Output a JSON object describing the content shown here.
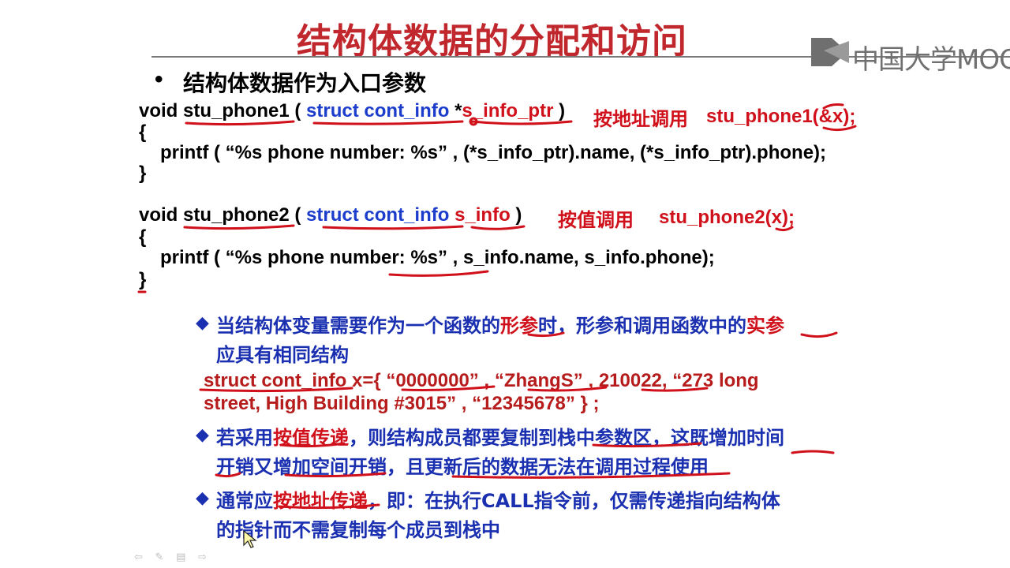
{
  "slide": {
    "title": "结构体数据的分配和访问",
    "logo_text": "中国大学MOOC",
    "bullet": "结构体数据作为入口参数",
    "func1": {
      "void": "void",
      "name": "stu_phone1",
      "paren_open": "(",
      "struct_type": "struct cont_info",
      "ptr_star": "*",
      "param": "s_info_ptr",
      "paren_close": ")",
      "call_label": "按地址调用",
      "call_example": "stu_phone1(&x);",
      "brace_open": "{",
      "body": "printf ( “%s phone number: %s” , (*s_info_ptr).name, (*s_info_ptr).phone);",
      "brace_close": "}"
    },
    "func2": {
      "void": "void",
      "name": "stu_phone2",
      "paren_open": "(",
      "struct_type": "struct cont_info",
      "param": "s_info",
      "paren_close": ")",
      "call_label": "按值调用",
      "call_example": "stu_phone2(x);",
      "brace_open": "{",
      "body": "printf ( “%s phone number: %s” , s_info.name, s_info.phone);",
      "brace_close": "}"
    },
    "notes": {
      "n1_a": "当结构体变量需要作为一个函数的",
      "n1_b": "形参",
      "n1_c": "时，形参和调用函数中的",
      "n1_d": "实参",
      "n1_line2": "应具有相同结构",
      "struct_line1": "struct cont_info x={ “0000000” ,  “ZhangS” , 210022,  “273 long",
      "struct_line2": "street, High Building #3015” ,  “12345678” } ;",
      "n2_a": "若采用",
      "n2_b": "按值传递",
      "n2_c": "，则结构成员都要复制到栈中参数区，这既增加时间",
      "n2_line2": "开销又增加空间开销，且更新后的数据无法在调用过程使用",
      "n3_a": "通常应",
      "n3_b": "按地址传递",
      "n3_c": "，即：在执行CALL指令前，仅需传递指向结构体",
      "n3_line2": "的指针而不需复制每个成员到栈中"
    },
    "nav_icons": [
      "back-arrow-icon",
      "pen-icon",
      "slides-icon",
      "forward-arrow-icon"
    ],
    "colors": {
      "title": "#c0282e",
      "code_blue": "#1c3ccc",
      "ink_red": "#d0101a",
      "note_blue": "#1a30b0"
    }
  }
}
